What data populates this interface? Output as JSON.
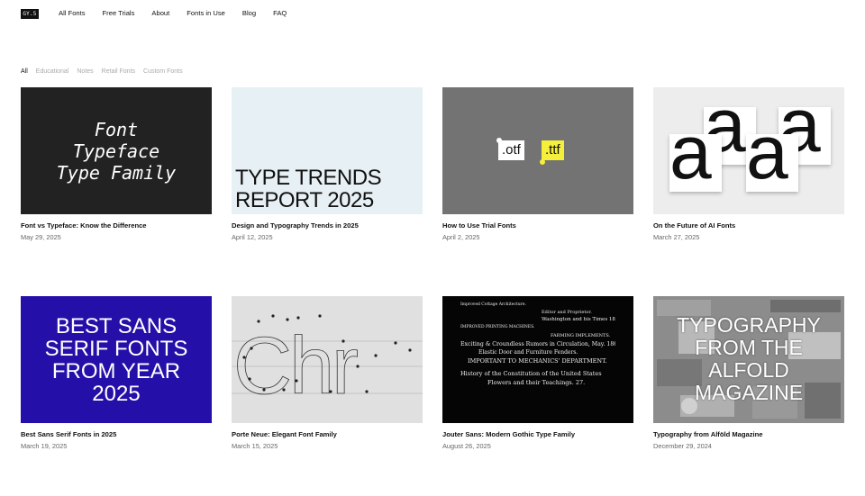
{
  "header": {
    "logo": "GY.5",
    "nav": [
      "All Fonts",
      "Free Trials",
      "About",
      "Fonts in Use",
      "Blog",
      "FAQ"
    ]
  },
  "filters": {
    "items": [
      "All",
      "Educational",
      "Notes",
      "Retail Fonts",
      "Custom Fonts"
    ],
    "active": "All"
  },
  "posts": [
    {
      "title": "Font vs Typeface: Know the Difference",
      "date": "May 29, 2025",
      "thumb_lines": [
        "Font",
        "Typeface",
        "Type Family"
      ]
    },
    {
      "title": "Design and Typography Trends in 2025",
      "date": "April 12, 2025",
      "thumb_lines": [
        "TYPE TRENDS",
        "REPORT 2025"
      ]
    },
    {
      "title": "How to Use Trial Fonts",
      "date": "April 2, 2025",
      "thumb_lines": [
        ".otf",
        ".ttf"
      ]
    },
    {
      "title": "On the Future of AI Fonts",
      "date": "March 27, 2025",
      "thumb_lines": [
        "a",
        "a",
        "a",
        "a"
      ]
    },
    {
      "title": "Best Sans Serif Fonts in 2025",
      "date": "March 19, 2025",
      "thumb_lines": [
        "BEST SANS",
        "SERIF FONTS",
        "FROM YEAR",
        "2025"
      ]
    },
    {
      "title": "Porte Neue: Elegant Font Family",
      "date": "March 15, 2025",
      "thumb_lines": [
        "Chr"
      ]
    },
    {
      "title": "Jouter Sans: Modern Gothic Type Family",
      "date": "August 26, 2025",
      "thumb_lines": [
        "Improved Cottage Architecture.",
        "Editor and Proprietor.",
        "Washington and his Times 18",
        "IMPROVED PRINTING MACHINES.",
        "FARMING IMPLEMENTS.",
        "Exciting & Croundless Rumors in Circulation, May. 1862.",
        "Elastic Door and Furniture Fenders.",
        "IMPORTANT TO MECHANICS' DEPARTMENT.",
        "History of the Constitution of the United States",
        "Flowers and their Teachings. 27."
      ]
    },
    {
      "title": "Typography from Alföld Magazine",
      "date": "December 29, 2024",
      "thumb_lines": [
        "TYPOGRAPHY",
        "FROM THE",
        "ALFOLD",
        "MAGAZINE"
      ]
    }
  ],
  "colors": {
    "text": "#111111",
    "muted": "#aaaaaa",
    "date": "#666666",
    "thumb1_bg": "#222222",
    "thumb2_bg": "#e7f0f4",
    "thumb3_bg": "#737373",
    "ttf_highlight": "#f5ee3b",
    "thumb5_bg": "#2410a8"
  }
}
